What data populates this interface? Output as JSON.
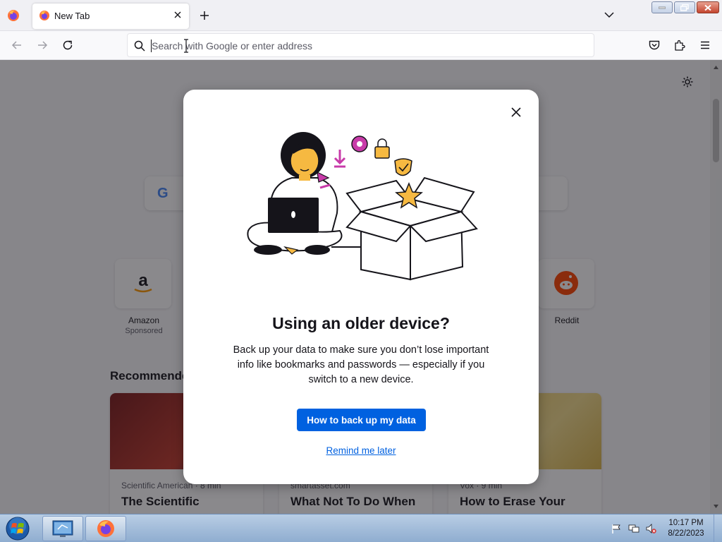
{
  "browser": {
    "tab": {
      "title": "New Tab"
    },
    "urlbar": {
      "placeholder": "Search with Google or enter address"
    }
  },
  "newtab": {
    "search_engine_logo": "G",
    "shortcuts": [
      {
        "name": "Amazon",
        "sub": "Sponsored",
        "icon": "amazon-icon"
      },
      {
        "name": "Reddit",
        "sub": "",
        "icon": "reddit-icon"
      }
    ],
    "recommended_heading": "Recommende",
    "stories": [
      {
        "source": "Scientific American · 8 min",
        "title": "The Scientific"
      },
      {
        "source": "smartasset.com",
        "title": "What Not To Do When"
      },
      {
        "source": "Vox · 9 min",
        "title": "How to Erase Your"
      }
    ]
  },
  "modal": {
    "title": "Using an older device?",
    "body": "Back up your data to make sure you don’t lose important info like bookmarks and passwords — especially if you switch to a new device.",
    "primary_button": "How to back up my data",
    "secondary_link": "Remind me later"
  },
  "taskbar": {
    "time": "10:17 PM",
    "date": "8/22/2023"
  },
  "colors": {
    "accent": "#0061e0",
    "overlay": "#15141a",
    "illustration_accent": "#f6b941",
    "illustration_magenta": "#c83ba9"
  }
}
